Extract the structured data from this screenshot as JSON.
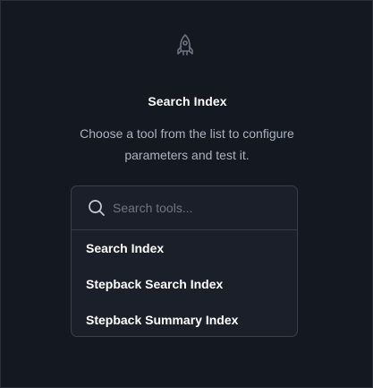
{
  "header": {
    "icon": "rocket-icon",
    "title": "Search Index",
    "description": "Choose a tool from the list to configure parameters and test it."
  },
  "search": {
    "placeholder": "Search tools...",
    "value": "",
    "icon": "search-icon"
  },
  "tools": [
    {
      "label": "Search Index"
    },
    {
      "label": "Stepback Search Index"
    },
    {
      "label": "Stepback Summary Index"
    }
  ],
  "colors": {
    "background": "#141821",
    "panel": "#1b1f29",
    "text": "#ffffff",
    "muted": "#aab3c2"
  }
}
